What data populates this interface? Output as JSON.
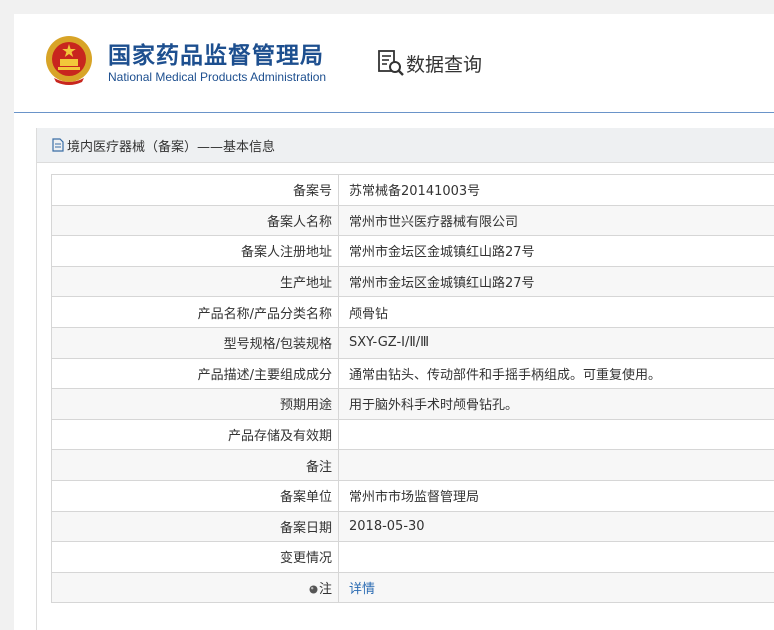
{
  "header": {
    "brand_cn": "国家药品监督管理局",
    "brand_en": "National Medical Products Administration",
    "query_label": "数据查询",
    "brand_color": "#1d4f8f",
    "emblem_icon": "national-emblem-icon",
    "query_icon": "document-search-icon"
  },
  "panel": {
    "title": "境内医疗器械（备案）——基本信息"
  },
  "rows": [
    {
      "label": "备案号",
      "value": "苏常械备20141003号"
    },
    {
      "label": "备案人名称",
      "value": "常州市世兴医疗器械有限公司"
    },
    {
      "label": "备案人注册地址",
      "value": "常州市金坛区金城镇红山路27号"
    },
    {
      "label": "生产地址",
      "value": "常州市金坛区金城镇红山路27号"
    },
    {
      "label": "产品名称/产品分类名称",
      "value": "颅骨钻"
    },
    {
      "label": "型号规格/包装规格",
      "value": "SXY-GZ-Ⅰ/Ⅱ/Ⅲ"
    },
    {
      "label": "产品描述/主要组成成分",
      "value": "通常由钻头、传动部件和手摇手柄组成。可重复使用。"
    },
    {
      "label": "预期用途",
      "value": "用于脑外科手术时颅骨钻孔。"
    },
    {
      "label": "产品存储及有效期",
      "value": ""
    },
    {
      "label": "备注",
      "value": ""
    },
    {
      "label": "备案单位",
      "value": "常州市市场监督管理局"
    },
    {
      "label": "备案日期",
      "value": "2018-05-30"
    },
    {
      "label": "变更情况",
      "value": ""
    },
    {
      "label": "注",
      "value": "详情"
    }
  ]
}
